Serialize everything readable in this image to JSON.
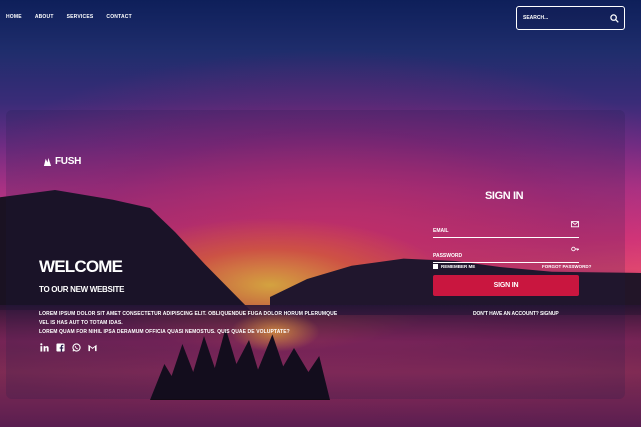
{
  "nav": {
    "links": [
      "HOME",
      "ABOUT",
      "SERVICES",
      "CONTACT"
    ],
    "search_placeholder": "SEARCH..."
  },
  "brand": {
    "name": "FUSH"
  },
  "hero": {
    "title": "WELCOME",
    "subtitle": "TO OUR NEW WEBSITE",
    "description_line1": "LOREM IPSUM DOLOR SIT AMET CONSECTETUR ADIPISCING ELIT. OBLIQUENDUE FUGA DOLOR HORUM PLERUMQUE VEL IS HAS AUT TO TOTAM IDAS.",
    "description_line2": "LOREM QUAM FOR NIHIL IPSA DERAMUM OFFICIA QUASI NEMOSTUS. QUIS QUAE DE VOLUPTATE?"
  },
  "social": [
    "linkedin-icon",
    "facebook-icon",
    "whatsapp-icon",
    "gmail-icon"
  ],
  "signin": {
    "title": "SIGN IN",
    "email_placeholder": "EMAIL",
    "password_placeholder": "PASSWORD",
    "remember_label": "REMEMBER ME",
    "forgot_label": "FORGOT PASSWORD?",
    "button_label": "SIGN IN",
    "signup_prompt": "DON'T HAVE AN ACCOUNT? SIGNUP"
  },
  "colors": {
    "accent": "#c9163f"
  }
}
